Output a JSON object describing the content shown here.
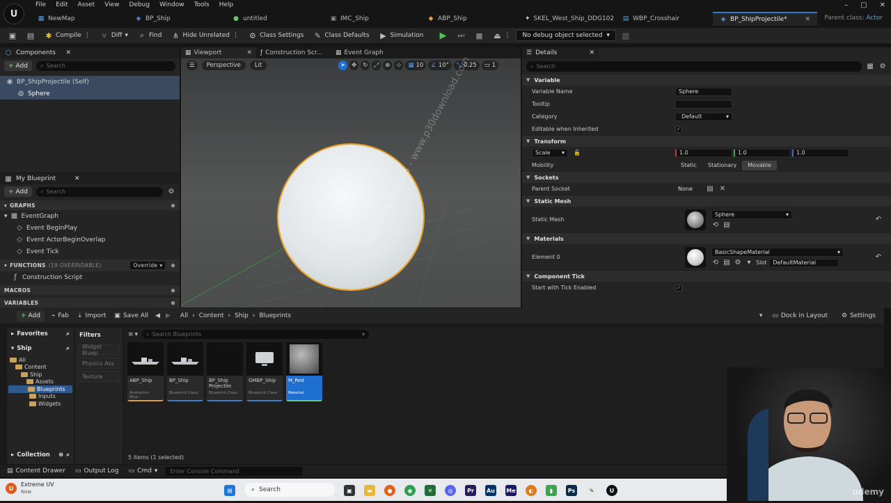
{
  "menu": [
    "File",
    "Edit",
    "Asset",
    "View",
    "Debug",
    "Window",
    "Tools",
    "Help"
  ],
  "tabs": [
    {
      "label": "NewMap",
      "icon": "level-icon"
    },
    {
      "label": "BP_Ship",
      "icon": "blueprint-icon"
    },
    {
      "label": "untitled",
      "icon": "material-icon"
    },
    {
      "label": "IMC_Ship",
      "icon": "input-icon"
    },
    {
      "label": "ABP_Ship",
      "icon": "animation-icon"
    },
    {
      "label": "SKEL_West_Ship_DDG102",
      "icon": "skeleton-icon"
    },
    {
      "label": "WBP_Crosshair",
      "icon": "widget-icon"
    },
    {
      "label": "BP_ShipProjectile*",
      "icon": "blueprint-icon"
    }
  ],
  "parent_class": {
    "label": "Parent class:",
    "value": "Actor"
  },
  "toolbar": {
    "compile": "Compile",
    "diff": "Diff",
    "find": "Find",
    "hide_unrelated": "Hide Unrelated",
    "class_settings": "Class Settings",
    "class_defaults": "Class Defaults",
    "simulation": "Simulation",
    "debug_object": "No debug object selected"
  },
  "components": {
    "title": "Components",
    "add": "Add",
    "search_placeholder": "Search",
    "items": [
      "BP_ShipProjectile (Self)",
      "Sphere"
    ]
  },
  "myblueprint": {
    "title": "My Blueprint",
    "add": "Add",
    "search_placeholder": "Search",
    "graphs_label": "GRAPHS",
    "event_graph": "EventGraph",
    "events": [
      "Event BeginPlay",
      "Event ActorBeginOverlap",
      "Event Tick"
    ],
    "functions_label": "FUNCTIONS",
    "functions_count": "(19 OVERRIDABLE)",
    "override": "Override",
    "construction": "Construction Script",
    "macros_label": "MACROS",
    "variables_label": "VARIABLES"
  },
  "center_tabs": [
    "Viewport",
    "Construction Scr...",
    "Event Graph"
  ],
  "viewport": {
    "perspective": "Perspective",
    "lit": "Lit",
    "grid": "10",
    "angle": "10°",
    "scale": "0.25",
    "camera": "1"
  },
  "details": {
    "title": "Details",
    "search_placeholder": "Search",
    "sections": {
      "variable": "Variable",
      "transform": "Transform",
      "sockets": "Sockets",
      "static_mesh": "Static Mesh",
      "materials": "Materials",
      "component_tick": "Component Tick"
    },
    "variable_name_label": "Variable Name",
    "variable_name": "Sphere",
    "tooltip_label": "Tooltip",
    "tooltip": "",
    "category_label": "Category",
    "category": "Default",
    "editable_label": "Editable when Inherited",
    "scale_label": "Scale",
    "scale_x": "1.0",
    "scale_y": "1.0",
    "scale_z": "1.0",
    "mobility_label": "Mobility",
    "mobility_options": [
      "Static",
      "Stationary",
      "Movable"
    ],
    "parent_socket_label": "Parent Socket",
    "parent_socket": "None",
    "static_mesh_label": "Static Mesh",
    "static_mesh": "Sphere",
    "element0_label": "Element 0",
    "element0": "BasicShapeMaterial",
    "slot_label": "Slot",
    "slot": "DefaultMaterial",
    "tick_label": "Start with Tick Enabled"
  },
  "content_browser": {
    "add": "Add",
    "fab": "Fab",
    "import": "Import",
    "save_all": "Save All",
    "path": [
      "All",
      "Content",
      "Ship",
      "Blueprints"
    ],
    "dock": "Dock in Layout",
    "settings": "Settings",
    "favorites": "Favorites",
    "ship": "Ship",
    "filters": "Filters",
    "filter_buttons": [
      "Widget Bluep",
      "Physics Ass",
      "Texture"
    ],
    "search_placeholder": "Search Blueprints",
    "tree": [
      "All",
      "Content",
      "Ship",
      "Assets",
      "Blueprints",
      "Inputs",
      "Widgets"
    ],
    "assets": [
      {
        "name": "ABP_Ship",
        "type": "Animation Blue..."
      },
      {
        "name": "BP_Ship",
        "type": "Blueprint Class"
      },
      {
        "name": "BP_Ship Projectile",
        "type": "Blueprint Class"
      },
      {
        "name": "GMBP_Ship",
        "type": "Blueprint Class"
      },
      {
        "name": "M_Red",
        "type": "Material"
      }
    ],
    "count": "5 items (1 selected)",
    "collection": "Collection"
  },
  "statusbar": {
    "content_drawer": "Content Drawer",
    "output_log": "Output Log",
    "cmd": "Cmd",
    "console_placeholder": "Enter Console Command",
    "source": "ontrol"
  },
  "taskbar": {
    "app": "Extreme UV",
    "app_sub": "Now",
    "search": "Search"
  },
  "watermark": "Copyright © 2025 - www.p30download.com",
  "corner_mark": "udemy"
}
